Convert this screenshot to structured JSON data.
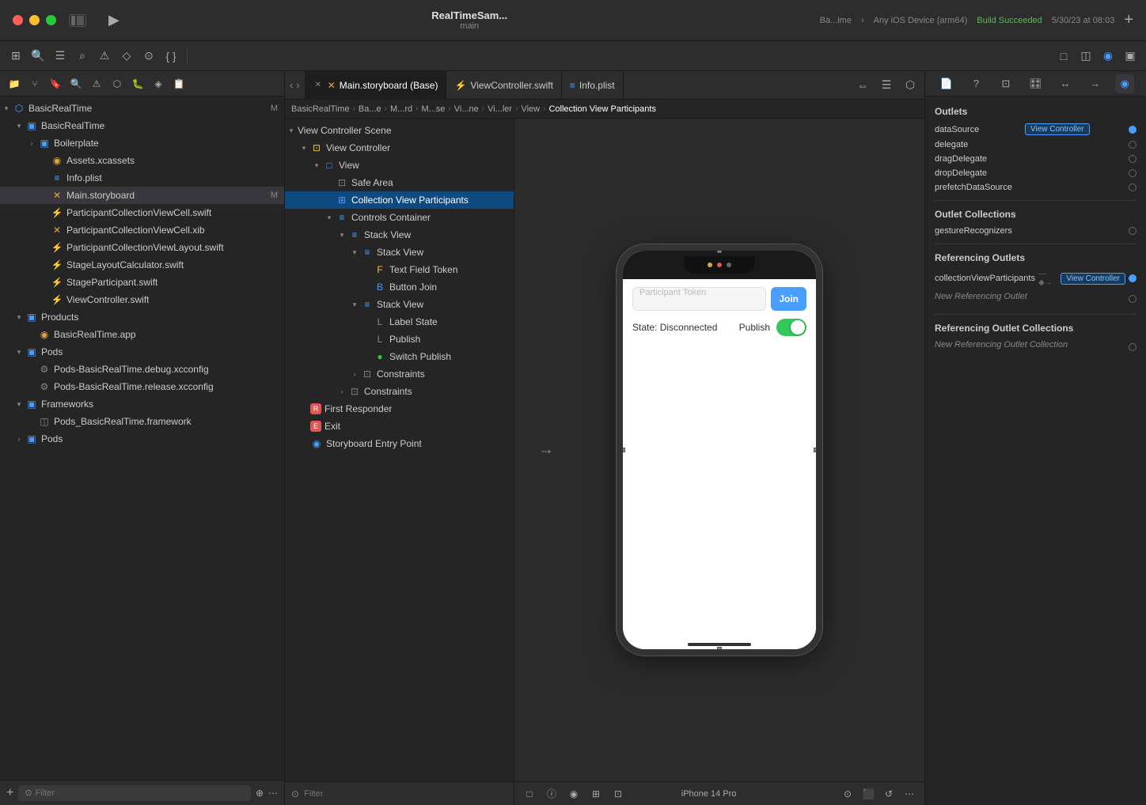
{
  "window": {
    "title": "RealTimeSam...",
    "subtitle": "main",
    "build_target": "Ba...ime",
    "device": "Any iOS Device (arm64)",
    "build_label": "Build Succeeded",
    "build_date": "5/30/23 at 08:03"
  },
  "tabs": [
    {
      "id": "main-storyboard",
      "label": "Main.storyboard (Base)",
      "type": "storyboard",
      "active": true,
      "closeable": true
    },
    {
      "id": "viewcontroller-swift",
      "label": "ViewController.swift",
      "type": "swift",
      "active": false,
      "closeable": false
    },
    {
      "id": "info-plist",
      "label": "Info.plist",
      "type": "plist",
      "active": false,
      "closeable": false
    }
  ],
  "breadcrumbs": [
    "BasicRealTime",
    "Ba...e",
    "M...rd",
    "M...se",
    "Vi...ne",
    "Vi...ler",
    "View",
    "Collection View Participants"
  ],
  "sidebar": {
    "root_label": "BasicRealTime",
    "items": [
      {
        "id": "basic-real-time-root",
        "label": "BasicRealTime",
        "indent": 0,
        "type": "project",
        "expanded": true,
        "badge": "M"
      },
      {
        "id": "basic-real-time-folder",
        "label": "BasicRealTime",
        "indent": 1,
        "type": "folder",
        "expanded": true
      },
      {
        "id": "boilerplate",
        "label": "Boilerplate",
        "indent": 2,
        "type": "folder",
        "expanded": false
      },
      {
        "id": "assets-xcassets",
        "label": "Assets.xcassets",
        "indent": 2,
        "type": "assets"
      },
      {
        "id": "info-plist",
        "label": "Info.plist",
        "indent": 2,
        "type": "plist"
      },
      {
        "id": "main-storyboard",
        "label": "Main.storyboard",
        "indent": 2,
        "type": "storyboard",
        "badge": "M"
      },
      {
        "id": "participant-cell-swift",
        "label": "ParticipantCollectionViewCell.swift",
        "indent": 2,
        "type": "swift"
      },
      {
        "id": "participant-cell-xib",
        "label": "ParticipantCollectionViewCell.xib",
        "indent": 2,
        "type": "xib"
      },
      {
        "id": "participant-layout-swift",
        "label": "ParticipantCollectionViewLayout.swift",
        "indent": 2,
        "type": "swift"
      },
      {
        "id": "stage-calc-swift",
        "label": "StageLayoutCalculator.swift",
        "indent": 2,
        "type": "swift"
      },
      {
        "id": "stage-participant-swift",
        "label": "StageParticipant.swift",
        "indent": 2,
        "type": "swift"
      },
      {
        "id": "viewcontroller-swift",
        "label": "ViewController.swift",
        "indent": 2,
        "type": "swift"
      },
      {
        "id": "products-folder",
        "label": "Products",
        "indent": 1,
        "type": "folder",
        "expanded": true
      },
      {
        "id": "basic-real-time-app",
        "label": "BasicRealTime.app",
        "indent": 2,
        "type": "app"
      },
      {
        "id": "pods-folder",
        "label": "Pods",
        "indent": 1,
        "type": "folder",
        "expanded": true
      },
      {
        "id": "pods-debug",
        "label": "Pods-BasicRealTime.debug.xcconfig",
        "indent": 2,
        "type": "config"
      },
      {
        "id": "pods-release",
        "label": "Pods-BasicRealTime.release.xcconfig",
        "indent": 2,
        "type": "config"
      },
      {
        "id": "frameworks-folder",
        "label": "Frameworks",
        "indent": 1,
        "type": "folder",
        "expanded": true
      },
      {
        "id": "pods-framework",
        "label": "Pods_BasicRealTime.framework",
        "indent": 2,
        "type": "framework"
      },
      {
        "id": "pods-root",
        "label": "Pods",
        "indent": 1,
        "type": "folder",
        "expanded": false
      }
    ]
  },
  "scene_outline": {
    "items": [
      {
        "id": "view-controller-scene",
        "label": "View Controller Scene",
        "indent": 0,
        "type": "scene",
        "expanded": true
      },
      {
        "id": "view-controller",
        "label": "View Controller",
        "indent": 1,
        "type": "view-controller",
        "expanded": true
      },
      {
        "id": "view",
        "label": "View",
        "indent": 2,
        "type": "view",
        "expanded": true
      },
      {
        "id": "safe-area",
        "label": "Safe Area",
        "indent": 3,
        "type": "safe-area"
      },
      {
        "id": "collection-view-participants",
        "label": "Collection View Participants",
        "indent": 3,
        "type": "collection-view",
        "selected": true
      },
      {
        "id": "controls-container",
        "label": "Controls Container",
        "indent": 3,
        "type": "stack-view",
        "expanded": true
      },
      {
        "id": "stack-view-1",
        "label": "Stack View",
        "indent": 4,
        "type": "stack-view",
        "expanded": true
      },
      {
        "id": "stack-view-2",
        "label": "Stack View",
        "indent": 5,
        "type": "stack-view",
        "expanded": true
      },
      {
        "id": "text-field-token",
        "label": "Text Field Token",
        "indent": 6,
        "type": "text-field"
      },
      {
        "id": "button-join",
        "label": "Button Join",
        "indent": 6,
        "type": "button"
      },
      {
        "id": "stack-view-3",
        "label": "Stack View",
        "indent": 5,
        "type": "stack-view",
        "expanded": true
      },
      {
        "id": "label-state",
        "label": "Label State",
        "indent": 6,
        "type": "label"
      },
      {
        "id": "label-publish",
        "label": "Publish",
        "indent": 6,
        "type": "label"
      },
      {
        "id": "switch-publish",
        "label": "Switch Publish",
        "indent": 6,
        "type": "switch"
      },
      {
        "id": "constraints-1",
        "label": "Constraints",
        "indent": 5,
        "type": "constraints",
        "expanded": false
      },
      {
        "id": "constraints-2",
        "label": "Constraints",
        "indent": 4,
        "type": "constraints",
        "expanded": false
      },
      {
        "id": "first-responder",
        "label": "First Responder",
        "indent": 1,
        "type": "first-responder"
      },
      {
        "id": "exit",
        "label": "Exit",
        "indent": 1,
        "type": "exit"
      },
      {
        "id": "storyboard-entry-point",
        "label": "Storyboard Entry Point",
        "indent": 1,
        "type": "entry-point"
      }
    ]
  },
  "canvas": {
    "device_label": "iPhone 14 Pro"
  },
  "iphone": {
    "token_placeholder": "Participant Token",
    "join_label": "Join",
    "state_label": "State: Disconnected",
    "publish_label": "Publish"
  },
  "outlets": {
    "title": "Outlets",
    "items": [
      {
        "id": "dataSource",
        "name": "dataSource",
        "target": "View Controller",
        "connected": true
      },
      {
        "id": "delegate",
        "name": "delegate",
        "target": null,
        "connected": false
      },
      {
        "id": "dragDelegate",
        "name": "dragDelegate",
        "target": null,
        "connected": false
      },
      {
        "id": "dropDelegate",
        "name": "dropDelegate",
        "target": null,
        "connected": false
      },
      {
        "id": "prefetchDataSource",
        "name": "prefetchDataSource",
        "target": null,
        "connected": false
      }
    ],
    "outlet_collections_title": "Outlet Collections",
    "outlet_collections": [
      {
        "id": "gestureRecognizers",
        "name": "gestureRecognizers",
        "connected": false
      }
    ],
    "referencing_outlets_title": "Referencing Outlets",
    "referencing_outlets": [
      {
        "id": "collectionViewParticipants",
        "name": "collectionViewParticipants",
        "target": "View Controller",
        "connected": true
      },
      {
        "id": "new-referencing-outlet",
        "name": "New Referencing Outlet",
        "target": null,
        "connected": false
      }
    ],
    "referencing_outlet_collections_title": "Referencing Outlet Collections",
    "referencing_outlet_collections": [
      {
        "id": "new-referencing-outlet-collection",
        "name": "New Referencing Outlet Collection",
        "target": null,
        "connected": false
      }
    ]
  },
  "bottom_bar": {
    "filter_placeholder": "Filter",
    "device": "iPhone 14 Pro"
  }
}
